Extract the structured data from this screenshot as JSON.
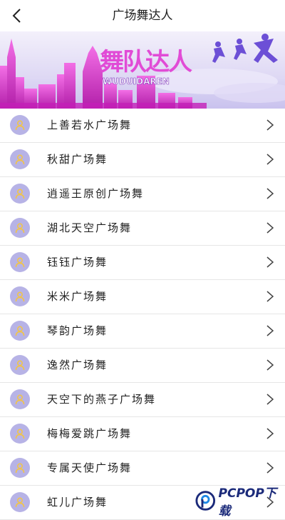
{
  "header": {
    "title": "广场舞达人",
    "back_icon": "chevron-left-icon"
  },
  "banner": {
    "title": "舞队达人",
    "subtitle": "WUDUIDAREN",
    "colors": {
      "accent": "#e14bd6",
      "sky": "#c8c6f0",
      "figure": "#6c4fd6"
    }
  },
  "list": {
    "items": [
      {
        "label": "上善若水广场舞"
      },
      {
        "label": "秋甜广场舞"
      },
      {
        "label": "逍遥王原创广场舞"
      },
      {
        "label": "湖北天空广场舞"
      },
      {
        "label": "钰钰广场舞"
      },
      {
        "label": "米米广场舞"
      },
      {
        "label": "琴韵广场舞"
      },
      {
        "label": "逸然广场舞"
      },
      {
        "label": "天空下的燕子广场舞"
      },
      {
        "label": "梅梅爱跳广场舞"
      },
      {
        "label": "专属天使广场舞"
      },
      {
        "label": "虹儿广场舞"
      }
    ],
    "avatar_icon": "user-icon",
    "chevron_icon": "chevron-right-icon",
    "avatar_color": "#b7b3e6"
  },
  "watermark": {
    "text": "PCPOP下载"
  }
}
